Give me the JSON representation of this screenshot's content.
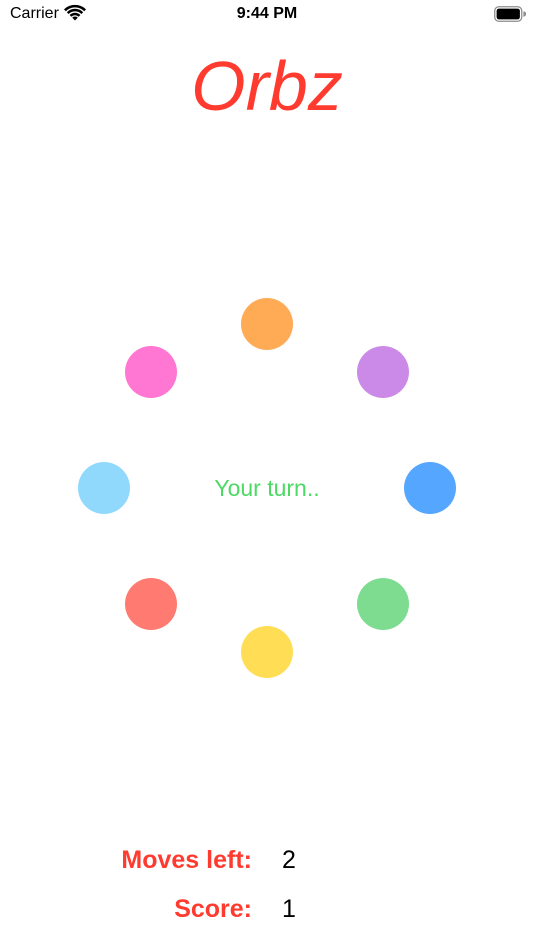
{
  "status_bar": {
    "carrier": "Carrier",
    "time": "9:44 PM"
  },
  "app": {
    "title": "Orbz",
    "title_color": "#ff3b30"
  },
  "game": {
    "status_text": "Your turn..",
    "status_color": "#4cd964",
    "orbs": [
      {
        "name": "orange",
        "color": "#ffaa55"
      },
      {
        "name": "purple",
        "color": "#cc8ae8"
      },
      {
        "name": "blue",
        "color": "#55a6ff"
      },
      {
        "name": "green",
        "color": "#7ddc8f"
      },
      {
        "name": "yellow",
        "color": "#ffdd55"
      },
      {
        "name": "red",
        "color": "#ff7b72"
      },
      {
        "name": "light-blue",
        "color": "#90d8fc"
      },
      {
        "name": "pink",
        "color": "#ff77d2"
      }
    ]
  },
  "stats": {
    "moves_label": "Moves left:",
    "moves_value": "2",
    "score_label": "Score:",
    "score_value": "1"
  }
}
